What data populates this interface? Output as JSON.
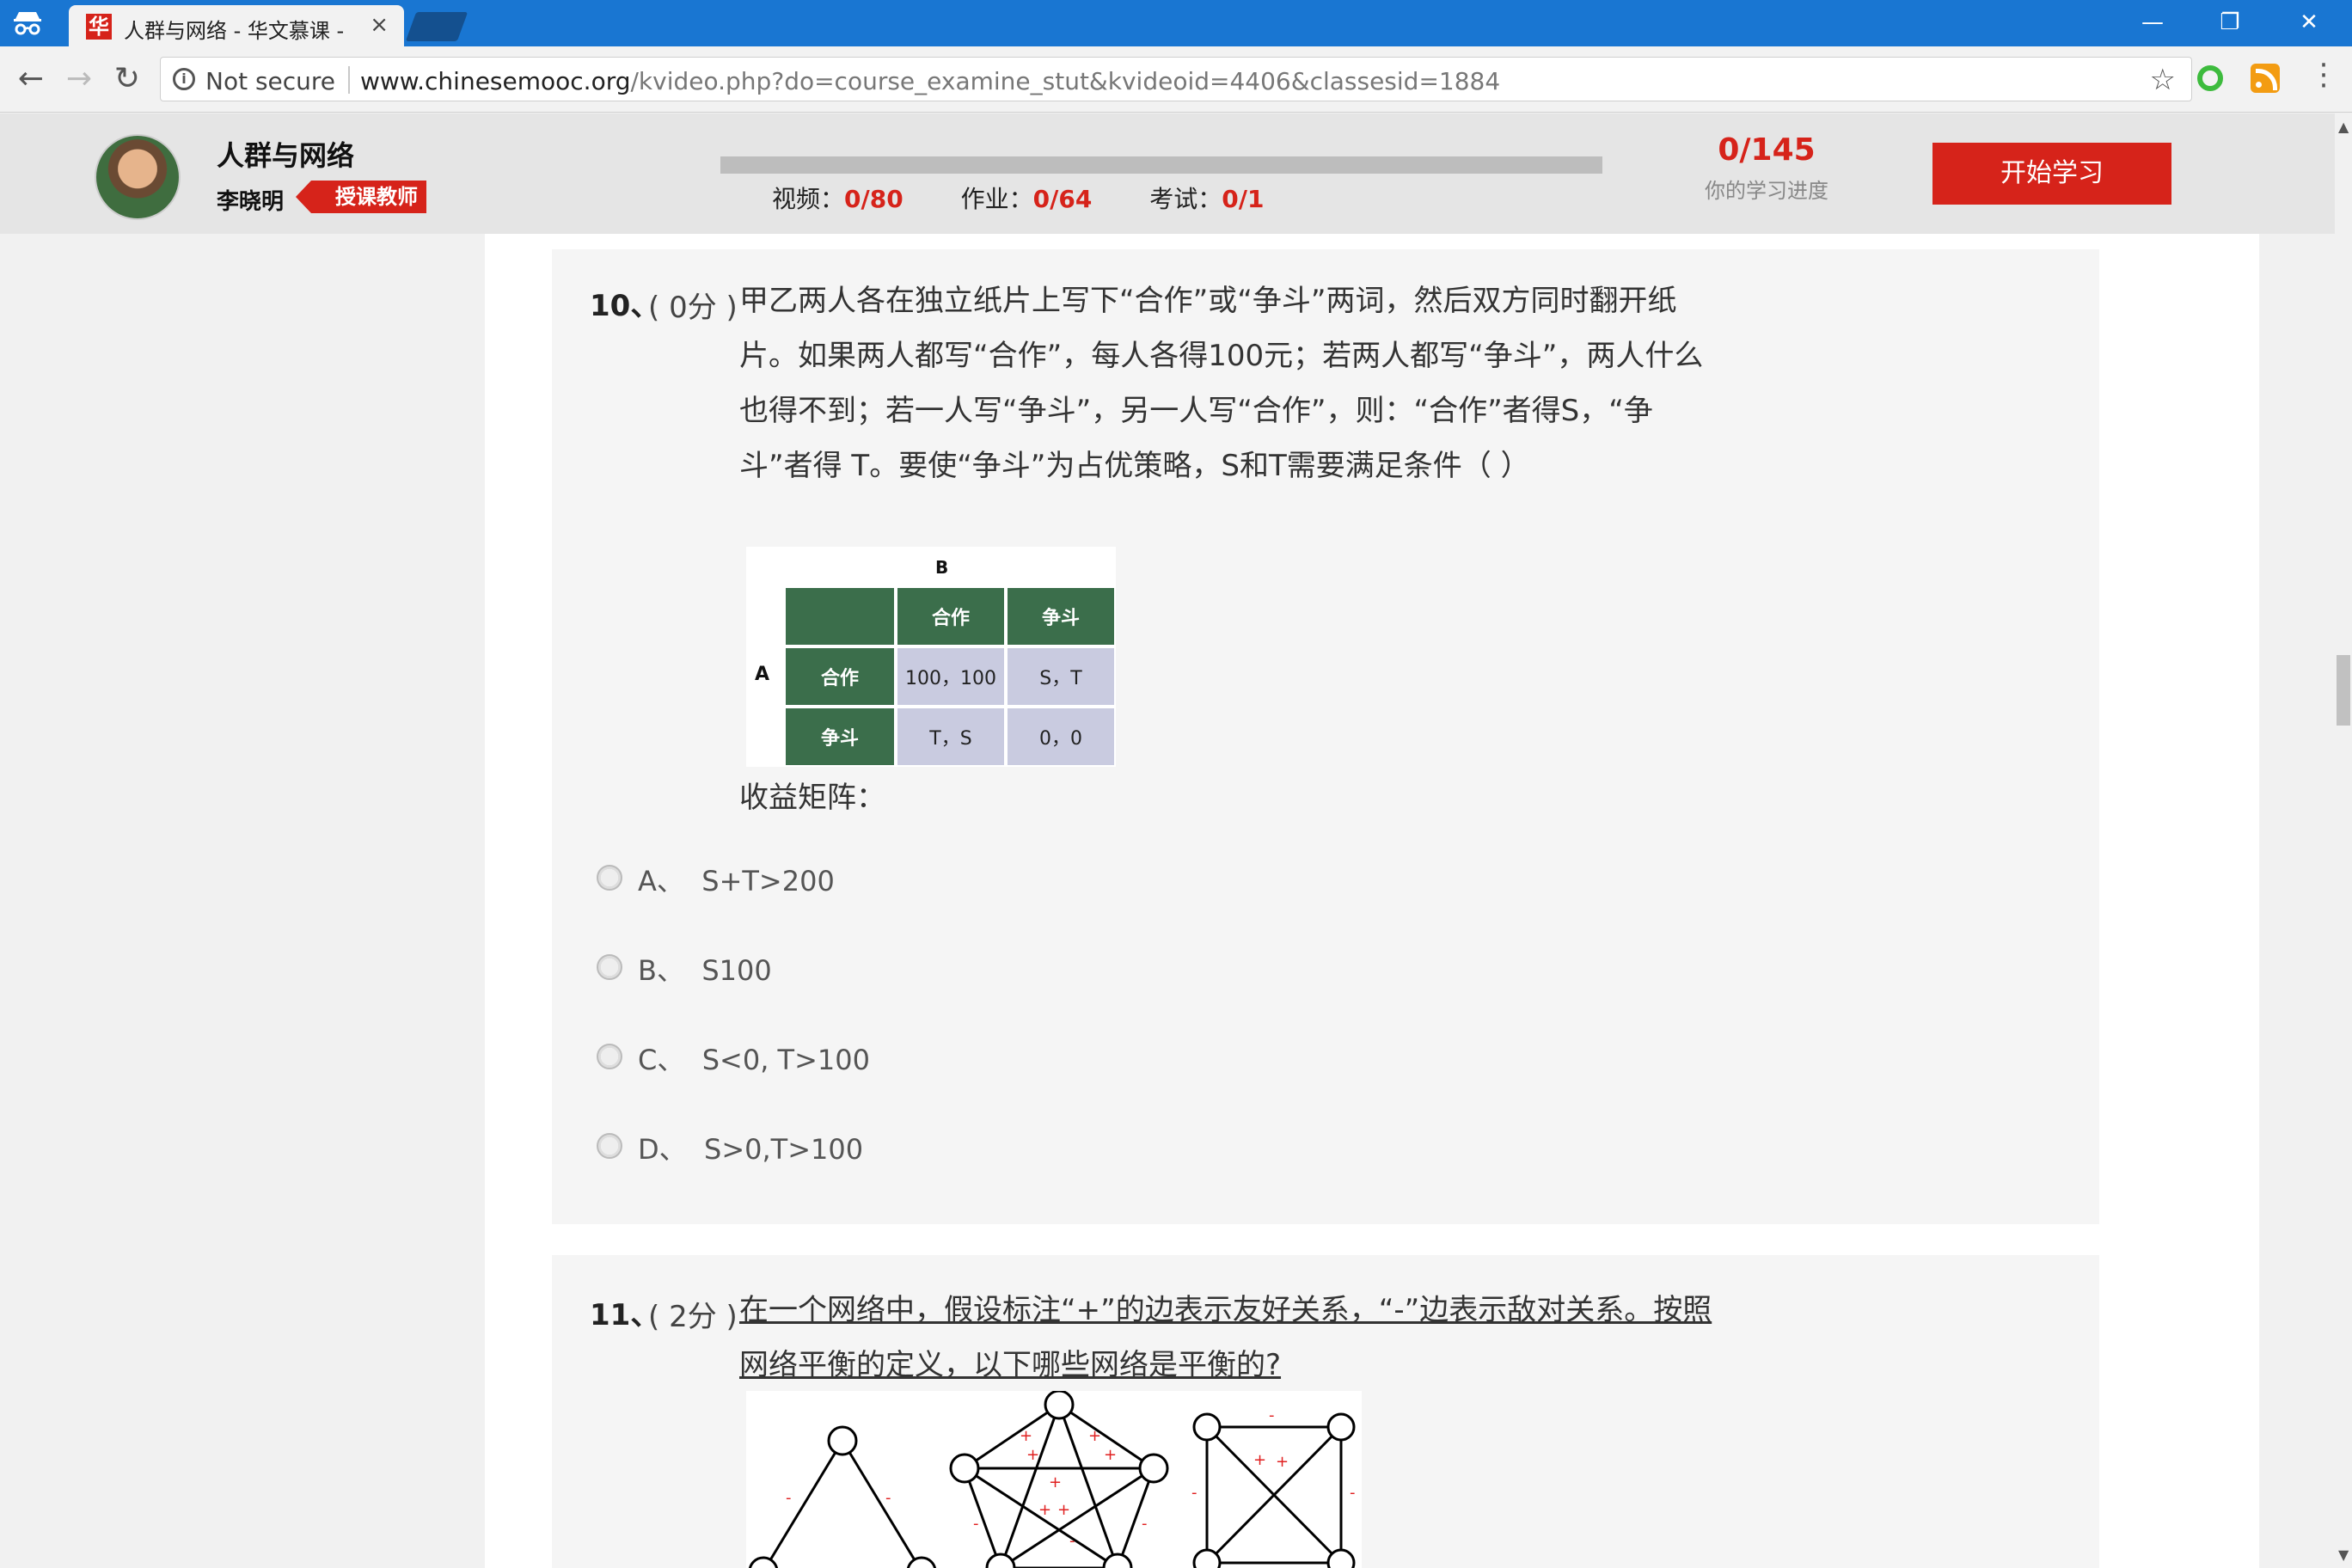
{
  "browser": {
    "tab_title": "人群与网络 - 华文慕课 -",
    "tab_favicon": "华",
    "security_label": "Not secure",
    "url_host": "www.chinesemooc.org",
    "url_path": "/kvideo.php?do=course_examine_stut&kvideoid=4406&classesid=1884",
    "icons": [
      "incognito-icon",
      "back-icon",
      "forward-icon",
      "reload-icon",
      "info-icon",
      "star-icon",
      "extension-icon",
      "rss-icon",
      "menu-icon"
    ]
  },
  "header": {
    "course_title": "人群与网络",
    "teacher_name": "李晓明",
    "teacher_badge": "授课教师",
    "progress_total": "0/145",
    "progress_label": "你的学习进度",
    "progress_fraction": 0,
    "stats": [
      {
        "label": "视频：",
        "value": "0/80"
      },
      {
        "label": "作业：",
        "value": "0/64"
      },
      {
        "label": "考试：",
        "value": "0/1"
      }
    ],
    "start_button": "开始学习"
  },
  "questions": [
    {
      "number": "10、",
      "score": "( 0分 )",
      "text": "甲乙两人各在独立纸片上写下“合作”或“争斗”两词，然后双方同时翻开纸片。如果两人都写“合作”，每人各得100元；若两人都写“争斗”，两人什么也得不到；若一人写“争斗”，另一人写“合作”，则：“合作”者得S，“争斗”者得 T。要使“争斗”为占优策略，S和T需要满足条件（    ）",
      "matrix": {
        "col_player": "B",
        "row_player": "A",
        "col_headers": [
          "合作",
          "争斗"
        ],
        "rows": [
          {
            "label": "合作",
            "cells": [
              "100，100",
              "S，T"
            ]
          },
          {
            "label": "争斗",
            "cells": [
              "T，S",
              "0，0"
            ]
          }
        ]
      },
      "matrix_caption": "收益矩阵：",
      "options": [
        {
          "letter": "A、",
          "text": "S+T>200"
        },
        {
          "letter": "B、",
          "text": "S100"
        },
        {
          "letter": "C、",
          "text": "S<0, T>100"
        },
        {
          "letter": "D、",
          "text": "S>0,T>100"
        }
      ]
    },
    {
      "number": "11、",
      "score": "( 2分 )",
      "text": "在一个网络中，假设标注“+”的边表示友好关系，“-”边表示敌对关系。按照网络平衡的定义，以下哪些网络是平衡的?",
      "edge_signs": [
        "+",
        "-"
      ]
    }
  ],
  "colors": {
    "browser_blue": "#1976d2",
    "accent_red": "#d6231a",
    "matrix_header_green": "#3b6e4b",
    "matrix_cell_lavender": "#c9cbe0",
    "edge_sign_red": "#e02020"
  }
}
